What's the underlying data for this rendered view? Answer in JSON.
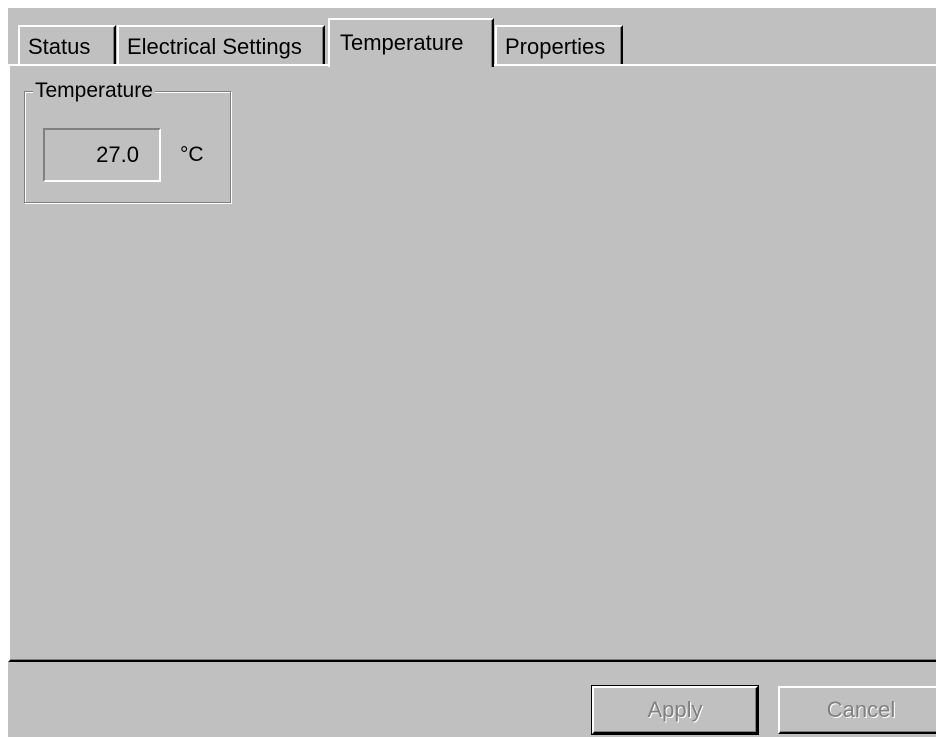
{
  "tabs": [
    {
      "label": "Status"
    },
    {
      "label": "Electrical Settings"
    },
    {
      "label": "Temperature"
    },
    {
      "label": "Properties"
    }
  ],
  "selected_tab": "Temperature",
  "temperature_group": {
    "title": "Temperature",
    "value": "27.0",
    "unit": "°C"
  },
  "buttons": {
    "apply": "Apply",
    "cancel": "Cancel"
  },
  "colors": {
    "face": "#c0c0c0",
    "highlight": "#ffffff",
    "shadow": "#808080",
    "dark_shadow": "#000000",
    "disabled_text": "#808080"
  }
}
